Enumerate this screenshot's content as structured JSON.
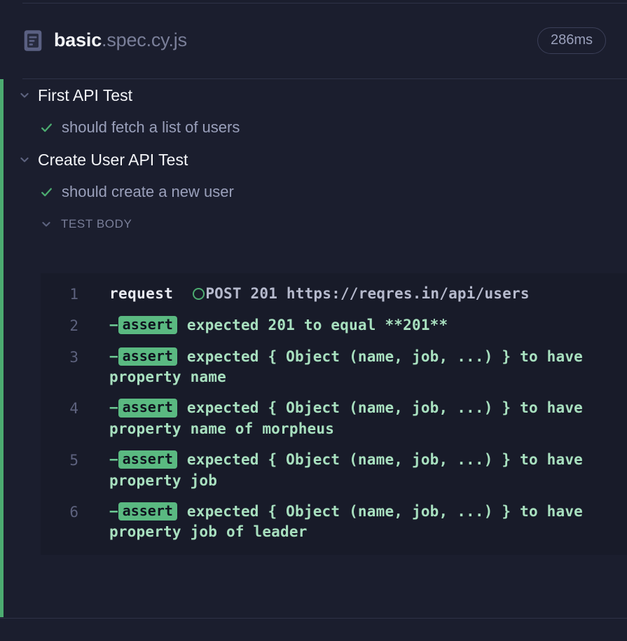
{
  "spec": {
    "file_icon": "file-document-icon",
    "name": "basic",
    "extension": ".spec.cy.js",
    "duration": "286ms"
  },
  "suites": [
    {
      "chevron_icon": "chevron-down-icon",
      "title": "First API Test",
      "tests": [
        {
          "status_icon": "check-icon",
          "title": "should fetch a list of users"
        }
      ]
    },
    {
      "chevron_icon": "chevron-down-icon",
      "title": "Create User API Test",
      "tests": [
        {
          "status_icon": "check-icon",
          "title": "should create a new user"
        }
      ],
      "section": {
        "chevron_icon": "chevron-down-icon",
        "label": "TEST BODY"
      }
    }
  ],
  "command_log": {
    "lines": [
      {
        "number": "1",
        "type": "request",
        "name": "request",
        "status_icon": "circle-outline-icon",
        "message": "POST 201 https://reqres.in/api/users"
      },
      {
        "number": "2",
        "type": "assert",
        "dash": "−",
        "badge": "assert",
        "message": "expected 201 to equal **201**"
      },
      {
        "number": "3",
        "type": "assert",
        "dash": "−",
        "badge": "assert",
        "message": "expected { Object (name, job, ...) } to have property name"
      },
      {
        "number": "4",
        "type": "assert",
        "dash": "−",
        "badge": "assert",
        "message": "expected { Object (name, job, ...) } to have property name of morpheus"
      },
      {
        "number": "5",
        "type": "assert",
        "dash": "−",
        "badge": "assert",
        "message": "expected { Object (name, job, ...) } to have property job"
      },
      {
        "number": "6",
        "type": "assert",
        "dash": "−",
        "badge": "assert",
        "message": "expected { Object (name, job, ...) } to have property job of leader"
      }
    ]
  },
  "colors": {
    "background": "#1b1e2e",
    "code_background": "#181b29",
    "pass_green": "#4cab70",
    "assert_badge": "#5ab981",
    "assert_text": "#a8e0bf",
    "divider": "#2e3247",
    "muted_text": "#9aa0bb"
  }
}
